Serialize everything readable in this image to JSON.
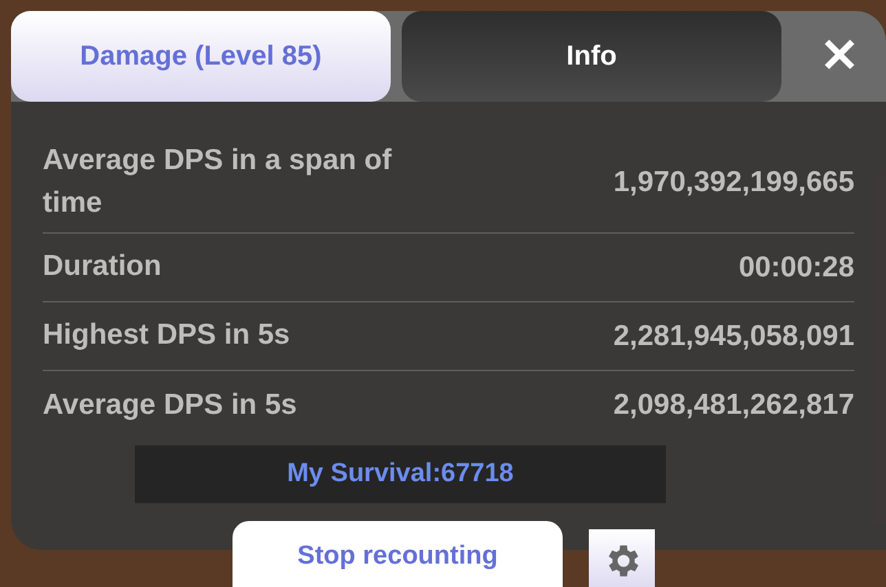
{
  "tabs": [
    {
      "label": "Damage (Level 85)",
      "selected": true
    },
    {
      "label": "Info",
      "selected": false
    }
  ],
  "close": {
    "label": "✕"
  },
  "stats": [
    {
      "label": "Average DPS in a span of time",
      "value": "1,970,392,199,665"
    },
    {
      "label": "Duration",
      "value": "00:00:28"
    },
    {
      "label": "Highest DPS in 5s",
      "value": "2,281,945,058,091"
    },
    {
      "label": "Average DPS in 5s",
      "value": "2,098,481,262,817"
    }
  ],
  "survival": "My Survival:67718",
  "stop_button": "Stop recounting"
}
